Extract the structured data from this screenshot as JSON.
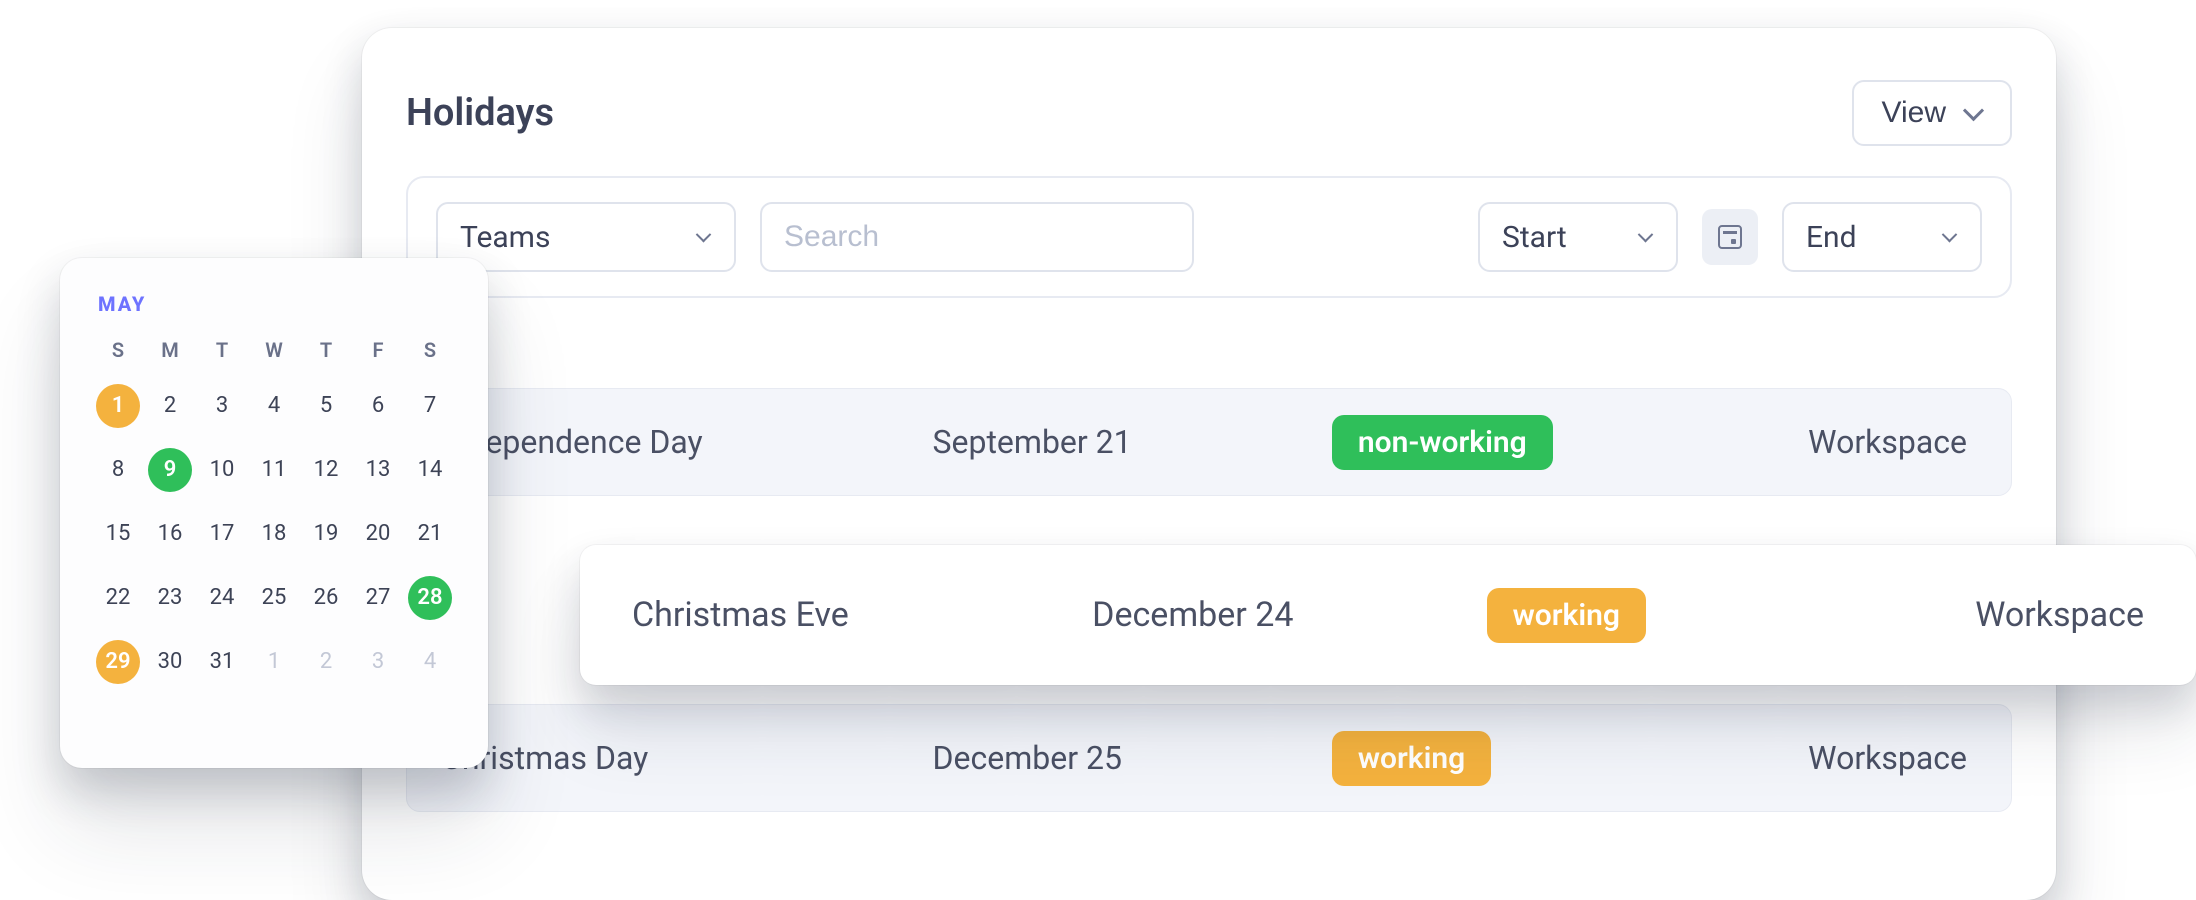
{
  "header": {
    "title": "Holidays",
    "view_label": "View"
  },
  "filters": {
    "teams_label": "Teams",
    "search_placeholder": "Search",
    "start_label": "Start",
    "end_label": "End"
  },
  "holidays": [
    {
      "name": "Independence Day",
      "date": "September 21",
      "status": "non-working",
      "status_color": "green",
      "scope": "Workspace"
    },
    {
      "name": "Christmas Eve",
      "date": "December 24",
      "status": "working",
      "status_color": "amber",
      "scope": "Workspace"
    },
    {
      "name": "Christmas Day",
      "date": "December 25",
      "status": "working",
      "status_color": "amber",
      "scope": "Workspace"
    }
  ],
  "calendar": {
    "month_label": "MAY",
    "weekdays": [
      "S",
      "M",
      "T",
      "W",
      "T",
      "F",
      "S"
    ],
    "weeks": [
      [
        {
          "d": "1",
          "c": "amber"
        },
        {
          "d": "2"
        },
        {
          "d": "3"
        },
        {
          "d": "4"
        },
        {
          "d": "5"
        },
        {
          "d": "6"
        },
        {
          "d": "7"
        }
      ],
      [
        {
          "d": "8"
        },
        {
          "d": "9",
          "c": "green"
        },
        {
          "d": "10"
        },
        {
          "d": "11"
        },
        {
          "d": "12"
        },
        {
          "d": "13"
        },
        {
          "d": "14"
        }
      ],
      [
        {
          "d": "15"
        },
        {
          "d": "16"
        },
        {
          "d": "17"
        },
        {
          "d": "18"
        },
        {
          "d": "19"
        },
        {
          "d": "20"
        },
        {
          "d": "21"
        }
      ],
      [
        {
          "d": "22"
        },
        {
          "d": "23"
        },
        {
          "d": "24"
        },
        {
          "d": "25"
        },
        {
          "d": "26"
        },
        {
          "d": "27"
        },
        {
          "d": "28",
          "c": "green"
        }
      ],
      [
        {
          "d": "29",
          "c": "amber"
        },
        {
          "d": "30"
        },
        {
          "d": "31"
        },
        {
          "d": "1",
          "out": true
        },
        {
          "d": "2",
          "out": true
        },
        {
          "d": "3",
          "out": true
        },
        {
          "d": "4",
          "out": true
        }
      ]
    ]
  }
}
